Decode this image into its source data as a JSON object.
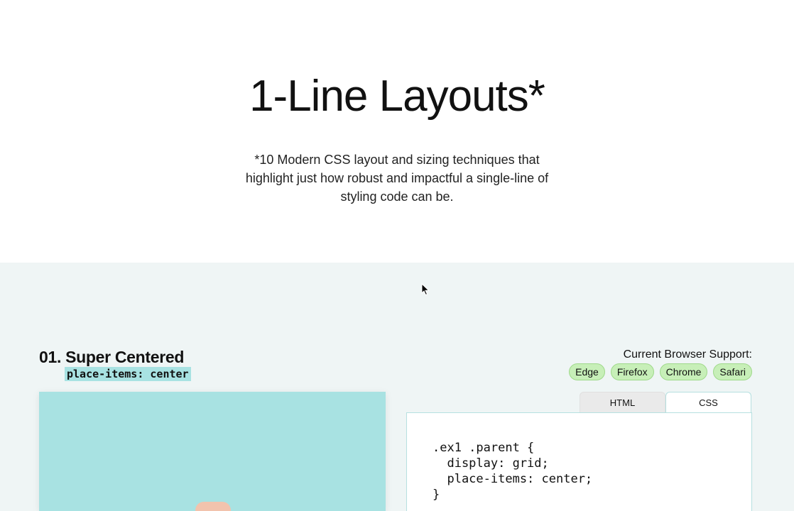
{
  "hero": {
    "title": "1-Line Layouts*",
    "subtitle": "*10 Modern CSS layout and sizing techniques that highlight just how robust and impactful a single-line of styling code can be."
  },
  "example": {
    "number": "01.",
    "title": "Super Centered",
    "code_tag": "place-items: center",
    "support_label": "Current Browser Support:",
    "browsers": [
      "Edge",
      "Firefox",
      "Chrome",
      "Safari"
    ],
    "tabs": [
      {
        "label": "HTML",
        "active": false
      },
      {
        "label": "CSS",
        "active": true
      }
    ],
    "code_lines": [
      ".ex1 .parent {",
      "  display: grid;",
      "  place-items: center;",
      "}"
    ]
  },
  "colors": {
    "demo_background": "#a8e2e2",
    "child_box": "#f2c3ad",
    "badge": "#c7efb8",
    "section_background": "#eff5f5"
  },
  "icons": {
    "cursor": "mouse-pointer-icon"
  }
}
